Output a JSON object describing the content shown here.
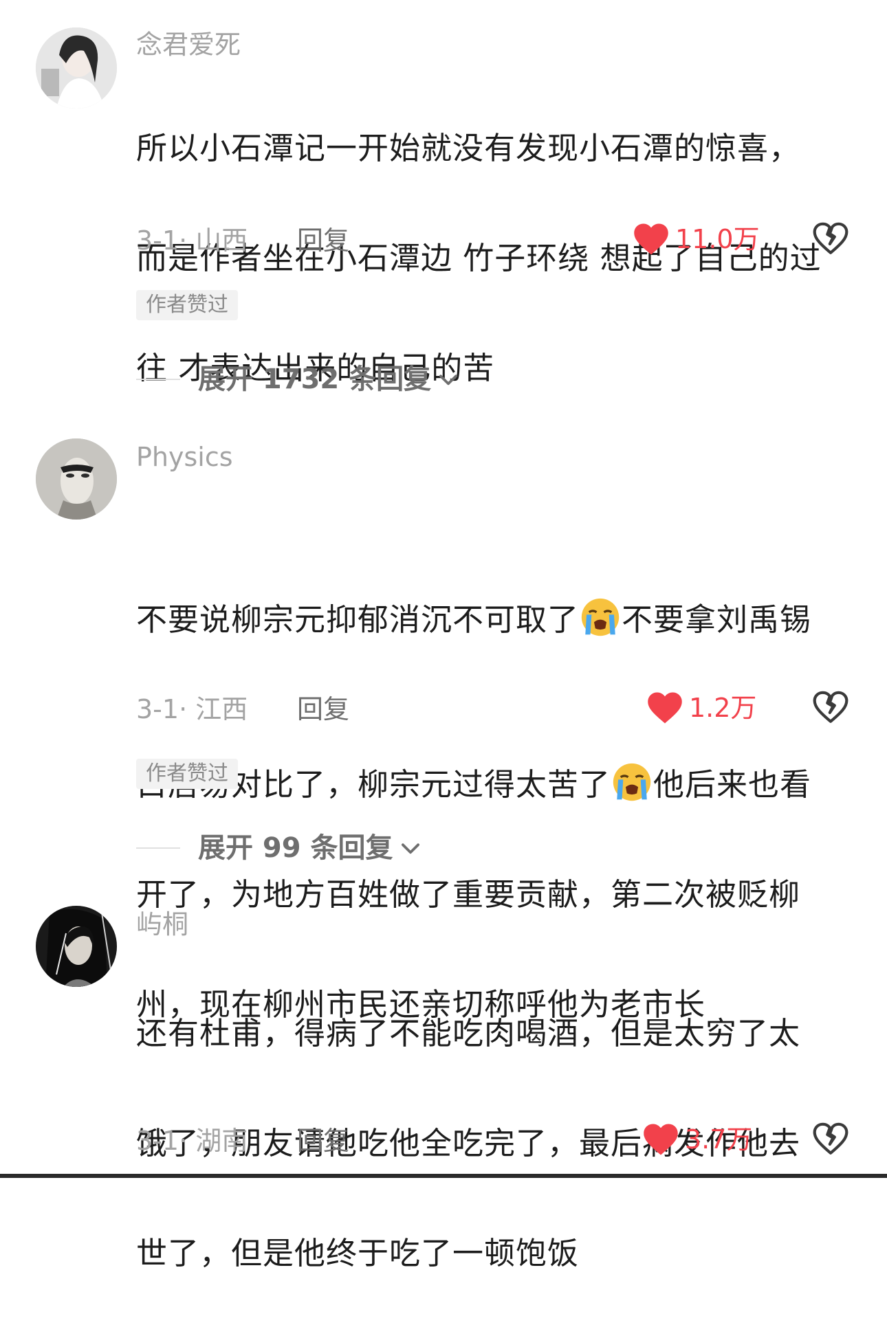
{
  "comments": [
    {
      "username": "念君爱死",
      "lines": [
        "所以小石潭记一开始就没有发现小石潭的惊喜，",
        "而是作者坐在小石潭边 竹子环绕 想起了自己的过",
        "往 才表达出来的自己的苦"
      ],
      "date_location": "3-1· 山西",
      "reply_label": "回复",
      "likes": "11.0万",
      "badge": "作者赞过",
      "expand_label": "展开 1732 条回复"
    },
    {
      "username": "Physics",
      "line1_a": "不要说柳宗元抑郁消沉不可取了",
      "line1_b": "不要拿刘禹锡",
      "line2_a": "白居易对比了，柳宗元过得太苦了",
      "line2_b": "他后来也看",
      "line3": "开了，为地方百姓做了重要贡献，第二次被贬柳",
      "line4": "州，现在柳州市民还亲切称呼他为老市长",
      "emoji_name": "loudly-crying-face-emoji",
      "date_location": "3-1· 江西",
      "reply_label": "回复",
      "likes": "1.2万",
      "badge": "作者赞过",
      "expand_label": "展开 99 条回复"
    },
    {
      "username": "屿桐",
      "lines": [
        "还有杜甫，得病了不能吃肉喝酒，但是太穷了太",
        "饿了，朋友请他吃他全吃完了，最后病发作他去",
        "世了，但是他终于吃了一顿饱饭"
      ],
      "date_location": "3-1· 湖南",
      "reply_label": "回复",
      "likes": "3.7万"
    }
  ],
  "colors": {
    "like": "#f2414b",
    "meta": "#a3a3a3",
    "text": "#1c1c1c"
  },
  "icons": [
    "heart-icon",
    "broken-heart-icon",
    "chevron-down-icon"
  ]
}
